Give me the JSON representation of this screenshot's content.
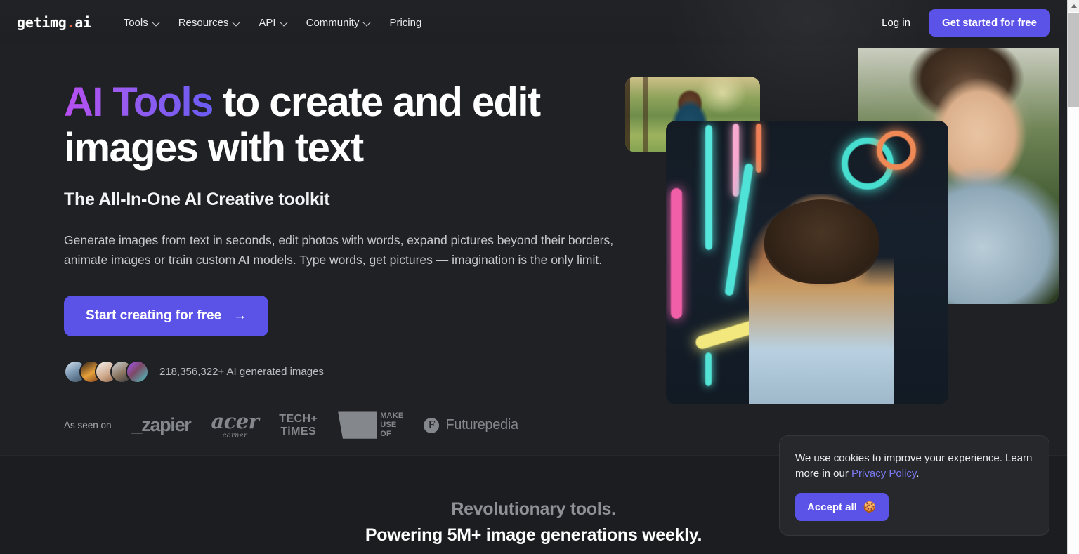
{
  "header": {
    "logo_text": "getimg",
    "logo_dot": ".",
    "logo_suffix": "ai",
    "nav": [
      {
        "label": "Tools",
        "has_chevron": true
      },
      {
        "label": "Resources",
        "has_chevron": true
      },
      {
        "label": "API",
        "has_chevron": true
      },
      {
        "label": "Community",
        "has_chevron": true
      },
      {
        "label": "Pricing",
        "has_chevron": false
      }
    ],
    "login_label": "Log in",
    "cta_label": "Get started for free"
  },
  "hero": {
    "title_highlight": "AI Tools",
    "title_rest": " to create and edit images with text",
    "subtitle": "The All-In-One AI Creative toolkit",
    "body": "Generate images from text in seconds, edit photos with words, expand pictures beyond their borders, animate images or train custom AI models. Type words, get pictures — imagination is the only limit.",
    "cta_label": "Start creating for free",
    "cta_arrow": "→",
    "proof_text": "218,356,322+ AI generated images",
    "avatar_count": 5,
    "seen_on_label": "As seen on",
    "brands": [
      {
        "name": "zapier",
        "text": "_zapier"
      },
      {
        "name": "acer-corner",
        "text": "acer",
        "sub": "corner"
      },
      {
        "name": "tech-times",
        "line1": "TECH+",
        "line2": "TiMES"
      },
      {
        "name": "make-use-of",
        "l1": "MAKE",
        "l2": "USE",
        "l3": "OF_"
      },
      {
        "name": "futurepedia",
        "mark": "F",
        "text": "Futurepedia"
      }
    ],
    "carousel_dots": 4,
    "carousel_active": 1,
    "images": [
      {
        "name": "park-portrait"
      },
      {
        "name": "neon-street-portrait"
      },
      {
        "name": "smiling-man-portrait"
      }
    ]
  },
  "lower": {
    "line1": "Revolutionary tools.",
    "line2": "Powering 5M+ image generations weekly."
  },
  "cookie": {
    "text_before": "We use cookies to improve your experience. Learn more in our ",
    "link": "Privacy Policy",
    "text_after": ".",
    "accept_label": "Accept all",
    "accept_emoji": "🍪"
  },
  "colors": {
    "accent": "#5b53e8",
    "link": "#7a79f2",
    "logo_dot": "#ef6444",
    "page_bg": "#1b1d21",
    "hero_bg": "#1f2124"
  }
}
